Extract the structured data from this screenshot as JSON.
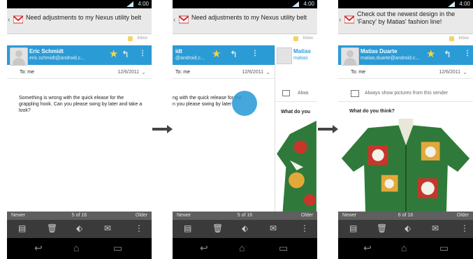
{
  "phones": [
    {
      "status": {
        "time": "4:00"
      },
      "subject": "Need adjustments to my Nexus utility belt",
      "label": "Inbox",
      "sender": {
        "name": "Eric Schmidt",
        "email": "eric.schmidt@android.c..."
      },
      "to": "To: me",
      "date": "12/6/2011",
      "body": "Something is wrong with the quick elease for the grappling hook. Can you please swng by later and take a look?",
      "pager": {
        "newer": "Newer",
        "count": "5 of 16",
        "older": "Older"
      }
    },
    {
      "status": {
        "time": "4:00"
      },
      "subject": "Need adjustments to my Nexus utility belt",
      "label": "Inbox",
      "sender": {
        "name": "idt",
        "email": "@android.c..."
      },
      "to": "To: me",
      "date": "12/6/2011",
      "body": "ng with the quick release for the\nn you please swing by later",
      "right_card": {
        "name": "Matias",
        "email": "matias",
        "imgtext": "Alwa",
        "question": "What do you"
      },
      "pager": {
        "newer": "Newer",
        "count": "5 of 16",
        "older": "Older"
      }
    },
    {
      "status": {
        "time": "4:00"
      },
      "subject": "Check out the newest design in the 'Fancy' by Matias' fashion line!",
      "label": "Inbox",
      "sender": {
        "name": "Matias Duarte",
        "email": "matias.duarte@android.c..."
      },
      "to": "To: me",
      "date": "12/6/2011",
      "imgtext": "Always show pictures from this sender",
      "question": "What do you think?",
      "pager": {
        "newer": "Newer",
        "count": "6 of 16",
        "older": "Older"
      }
    }
  ],
  "colors": {
    "accent": "#2b9bd6",
    "star": "#ffd23a",
    "toolbar": "#3a3a3a"
  }
}
